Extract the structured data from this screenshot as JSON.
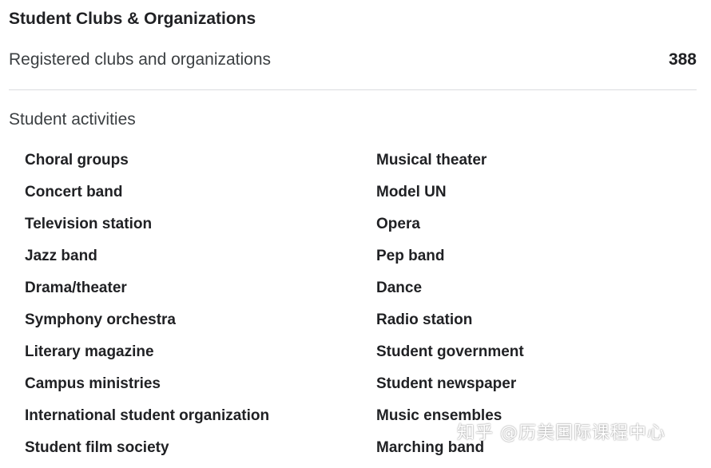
{
  "header": {
    "title": "Student Clubs & Organizations"
  },
  "stats": {
    "registered_label": "Registered clubs and organizations",
    "registered_value": "388"
  },
  "activities": {
    "section_label": "Student activities",
    "items": [
      "Choral groups",
      "Concert band",
      "Television station",
      "Jazz band",
      "Drama/theater",
      "Symphony orchestra",
      "Literary magazine",
      "Campus ministries",
      "International student organization",
      "Student film society",
      "Musical theater",
      "Model UN",
      "Opera",
      "Pep band",
      "Dance",
      "Radio station",
      "Student government",
      "Student newspaper",
      "Music ensembles",
      "Marching band"
    ]
  },
  "watermark": {
    "text": "知乎 @历美国际课程中心"
  }
}
